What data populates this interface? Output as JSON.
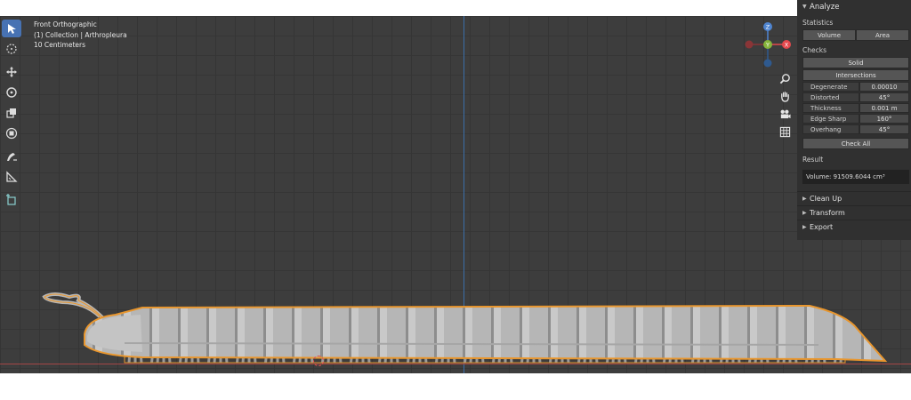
{
  "viewport": {
    "view_name": "Front Orthographic",
    "collection": "(1) Collection | Arthropleura",
    "scale": "10 Centimeters"
  },
  "toolbar": {
    "tools": [
      {
        "name": "select-cursor-icon",
        "active": true
      },
      {
        "name": "cursor-circle-icon",
        "active": false
      },
      {
        "name": "move-arrows-icon",
        "active": false
      },
      {
        "name": "rotate-icon",
        "active": false
      },
      {
        "name": "scale-icon",
        "active": false
      },
      {
        "name": "transform-icon",
        "active": false
      },
      {
        "name": "annotate-icon",
        "active": false
      },
      {
        "name": "measure-icon",
        "active": false
      },
      {
        "name": "add-cube-icon",
        "active": false
      }
    ]
  },
  "gizmo": {
    "z": "Z",
    "y": "Y",
    "x": "X",
    "colors": {
      "x": "#e5484d",
      "y": "#86b43b",
      "z": "#4f85d1",
      "neg_x": "#8a3537",
      "neg_z": "#2f5a8f"
    }
  },
  "nav": [
    "zoom-icon",
    "hand-pan-icon",
    "camera-icon",
    "grid-icon"
  ],
  "panel": {
    "title": "Analyze",
    "statistics_label": "Statistics",
    "stats_buttons": [
      "Volume",
      "Area"
    ],
    "checks_label": "Checks",
    "solid": "Solid",
    "intersections": "Intersections",
    "checks": [
      {
        "label": "Degenerate",
        "value": "0.00010"
      },
      {
        "label": "Distorted",
        "value": "45°"
      },
      {
        "label": "Thickness",
        "value": "0.001 m"
      },
      {
        "label": "Edge Sharp",
        "value": "160°"
      },
      {
        "label": "Overhang",
        "value": "45°"
      }
    ],
    "check_all": "Check All",
    "result_label": "Result",
    "result_value": "Volume: 91509.6044 cm³",
    "sections": [
      "Clean Up",
      "Transform",
      "Export"
    ]
  },
  "colors": {
    "viewport_bg": "#3d3d3d",
    "grid": "#353535",
    "selection_outline": "#e8962e",
    "model": "#b9b9b9",
    "active_tool": "#4772b3"
  }
}
